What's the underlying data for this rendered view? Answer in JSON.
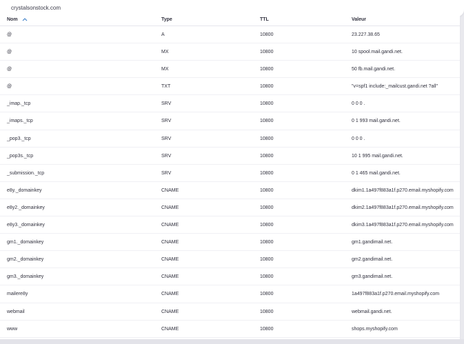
{
  "domain": "crystalsonstock.com",
  "columns": {
    "name": "Nom",
    "type": "Type",
    "ttl": "TTL",
    "value": "Valeur"
  },
  "records": [
    {
      "name": "@",
      "type": "A",
      "ttl": "10800",
      "value": "23.227.38.65"
    },
    {
      "name": "@",
      "type": "MX",
      "ttl": "10800",
      "value": "10 spool.mail.gandi.net."
    },
    {
      "name": "@",
      "type": "MX",
      "ttl": "10800",
      "value": "50 fb.mail.gandi.net."
    },
    {
      "name": "@",
      "type": "TXT",
      "ttl": "10800",
      "value": "\"v=spf1 include:_mailcust.gandi.net ?all\""
    },
    {
      "name": "_imap._tcp",
      "type": "SRV",
      "ttl": "10800",
      "value": "0 0 0 ."
    },
    {
      "name": "_imaps._tcp",
      "type": "SRV",
      "ttl": "10800",
      "value": "0 1 993 mail.gandi.net."
    },
    {
      "name": "_pop3._tcp",
      "type": "SRV",
      "ttl": "10800",
      "value": "0 0 0 ."
    },
    {
      "name": "_pop3s._tcp",
      "type": "SRV",
      "ttl": "10800",
      "value": "10 1 995 mail.gandi.net."
    },
    {
      "name": "_submission._tcp",
      "type": "SRV",
      "ttl": "10800",
      "value": "0 1 465 mail.gandi.net."
    },
    {
      "name": "e8y._domainkey",
      "type": "CNAME",
      "ttl": "10800",
      "value": "dkim1.1a497f883a1f.p270.email.myshopify.com"
    },
    {
      "name": "e8y2._domainkey",
      "type": "CNAME",
      "ttl": "10800",
      "value": "dkim2.1a497f883a1f.p270.email.myshopify.com"
    },
    {
      "name": "e8y3._domainkey",
      "type": "CNAME",
      "ttl": "10800",
      "value": "dkim3.1a497f883a1f.p270.email.myshopify.com"
    },
    {
      "name": "gm1._domainkey",
      "type": "CNAME",
      "ttl": "10800",
      "value": "gm1.gandimail.net."
    },
    {
      "name": "gm2._domainkey",
      "type": "CNAME",
      "ttl": "10800",
      "value": "gm2.gandimail.net."
    },
    {
      "name": "gm3._domainkey",
      "type": "CNAME",
      "ttl": "10800",
      "value": "gm3.gandimail.net."
    },
    {
      "name": "mailere8y",
      "type": "CNAME",
      "ttl": "10800",
      "value": "1a497f883a1f.p270.email.myshopify.com"
    },
    {
      "name": "webmail",
      "type": "CNAME",
      "ttl": "10800",
      "value": "webmail.gandi.net."
    },
    {
      "name": "www",
      "type": "CNAME",
      "ttl": "10800",
      "value": "shops.myshopify.com"
    }
  ],
  "colors": {
    "accent": "#3c7fc7",
    "text": "#2f2f3c",
    "row_border": "#f0f0f4"
  },
  "icons": {
    "sort": "chevron-up-icon"
  }
}
